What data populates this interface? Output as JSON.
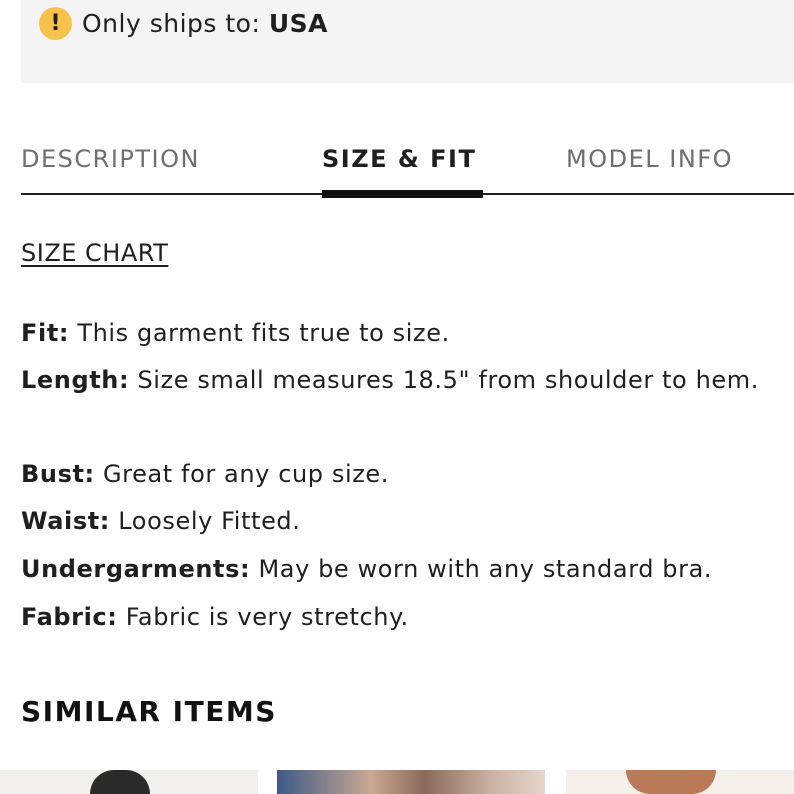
{
  "shipping": {
    "icon": "exclamation-icon",
    "icon_glyph": "!",
    "label": "Only ships to:",
    "country": "USA"
  },
  "tabs": [
    {
      "label": "DESCRIPTION",
      "active": false
    },
    {
      "label": "SIZE & FIT",
      "active": true
    },
    {
      "label": "MODEL INFO",
      "active": false
    }
  ],
  "size_chart_link": "SIZE CHART",
  "fit_details": [
    {
      "key": "Fit:",
      "value": "This garment fits true to size."
    },
    {
      "key": "Length:",
      "value": "Size small measures 18.5\" from shoulder to hem."
    },
    {
      "key": "Bust:",
      "value": "Great for any cup size."
    },
    {
      "key": "Waist:",
      "value": "Loosely Fitted."
    },
    {
      "key": "Undergarments:",
      "value": "May be worn with any standard bra."
    },
    {
      "key": "Fabric:",
      "value": "Fabric is very stretchy."
    }
  ],
  "similar_items": {
    "title": "SIMILAR ITEMS"
  },
  "colors": {
    "warning": "#f6c24a",
    "active_tab": "#111111",
    "inactive_tab": "#6f6f6f"
  }
}
